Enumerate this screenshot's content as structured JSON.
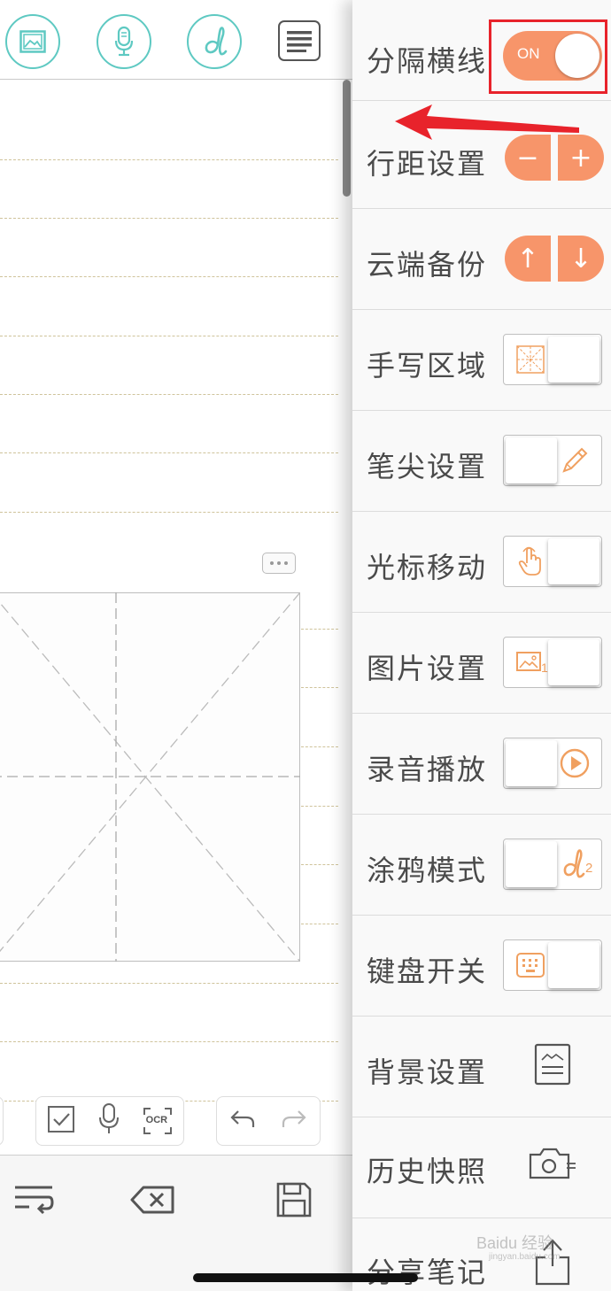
{
  "toolbar": {
    "icons": [
      "image-icon",
      "microphone-icon",
      "handwriting-d-icon",
      "menu-list-icon"
    ]
  },
  "sub_toolbar": {
    "ocr_label": "OCR",
    "icons": [
      "checkbox-icon",
      "microphone-icon",
      "ocr-icon",
      "undo-icon",
      "redo-icon"
    ]
  },
  "bottom_bar": {
    "icons": [
      "line-wrap-icon",
      "backspace-icon",
      "save-icon"
    ]
  },
  "settings": {
    "divider_lines": {
      "label": "分隔横线",
      "toggle_text": "ON",
      "state": "on"
    },
    "line_spacing": {
      "label": "行距设置",
      "minus": "−",
      "plus": "+"
    },
    "cloud_backup": {
      "label": "云端备份",
      "up": "↑",
      "down": "↓"
    },
    "handwriting_area": {
      "label": "手写区域"
    },
    "pen_tip": {
      "label": "笔尖设置"
    },
    "cursor_move": {
      "label": "光标移动"
    },
    "image_settings": {
      "label": "图片设置",
      "badge": "1"
    },
    "audio_playback": {
      "label": "录音播放"
    },
    "doodle_mode": {
      "label": "涂鸦模式",
      "badge": "2"
    },
    "keyboard_switch": {
      "label": "键盘开关"
    },
    "background": {
      "label": "背景设置"
    },
    "history_snapshot": {
      "label": "历史快照"
    },
    "share_note": {
      "label": "分享笔记"
    }
  },
  "colors": {
    "accent_orange": "#f7956a",
    "teal": "#5ec9c2",
    "highlight_red": "#e8232b"
  },
  "watermark": {
    "text": "Baidu 经验",
    "sub": "jingyan.baidu.com"
  }
}
